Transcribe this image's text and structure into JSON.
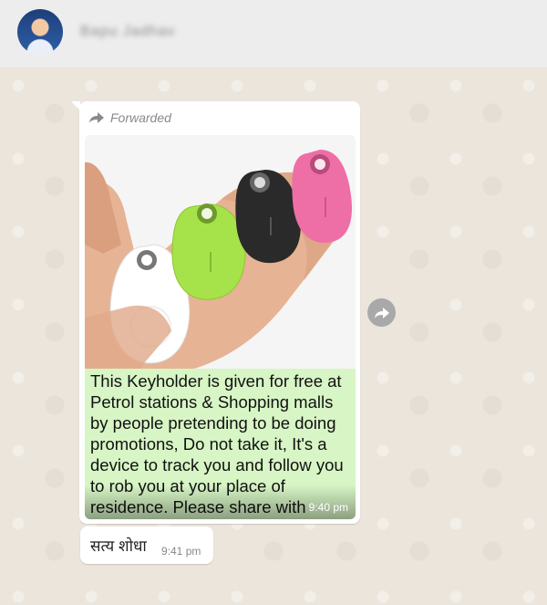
{
  "header": {
    "contact_name": "Bapu Jadhav"
  },
  "messages": [
    {
      "forwarded_label": "Forwarded",
      "caption": "This Keyholder is given for free at Petrol stations & Shopping malls by people pretending to be doing promotions, Do not take it, It's a device to track you and follow you to rob you at your place of residence.  Please share with family and friends",
      "time": "9:40 pm"
    },
    {
      "text": "सत्य शोधा",
      "time": "9:41 pm"
    }
  ],
  "colors": {
    "header_bg": "#ededed",
    "caption_bg": "#d7f5c5",
    "tracker_white": "#ffffff",
    "tracker_green": "#a6e34a",
    "tracker_black": "#2a2a2a",
    "tracker_pink": "#ee6fa5"
  },
  "icons": {
    "forward": "forward-arrow-icon",
    "share": "share-forward-icon"
  }
}
